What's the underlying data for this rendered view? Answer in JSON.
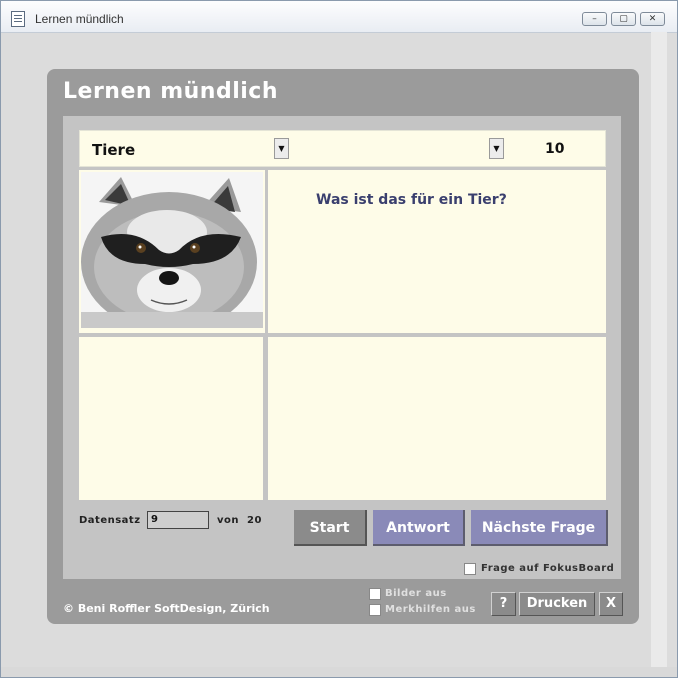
{
  "window": {
    "title": "Lernen mündlich",
    "controls": [
      "–",
      "▢",
      "✕"
    ]
  },
  "app": {
    "heading": "Lernen mündlich",
    "topic": "Tiere",
    "second_dropdown": "",
    "count": "10",
    "question": "Was ist das für ein Tier?",
    "image_icon": "raccoon-photo",
    "record": {
      "label": "Datensatz",
      "value": "9",
      "of_label": "von",
      "total": "20"
    },
    "buttons": {
      "start": "Start",
      "answer": "Antwort",
      "next": "Nächste Frage"
    },
    "fokus_checkbox": "Frage auf FokusBoard",
    "footer": {
      "copyright": "© Beni Roffler SoftDesign, Zürich",
      "pictures_off": "Bilder aus",
      "hints_off": "Merkhilfen aus",
      "help": "?",
      "print": "Drucken",
      "close": "X"
    }
  },
  "colors": {
    "panel": "#9b9b9b",
    "cream": "#fefce8",
    "button_purple": "#8a8ab8",
    "question_text": "#3a3f6e"
  }
}
